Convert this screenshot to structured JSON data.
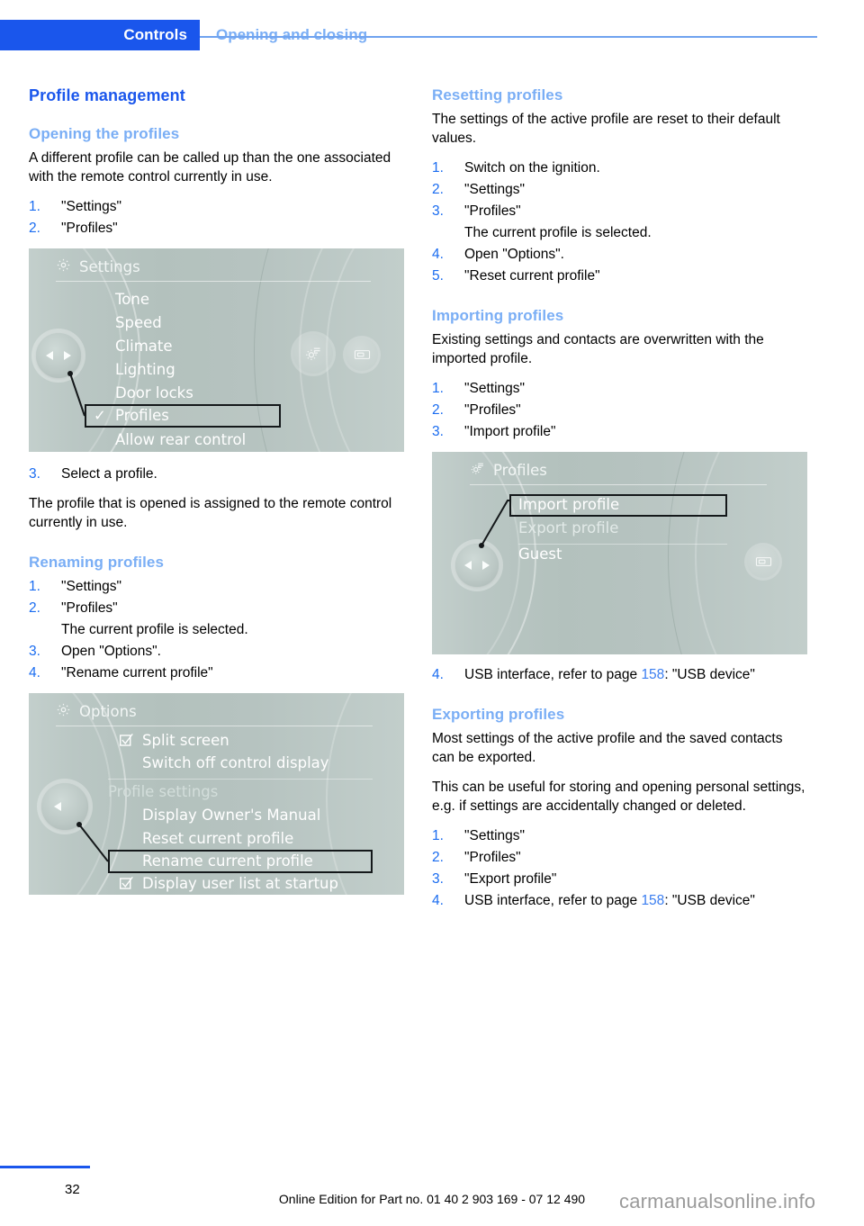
{
  "header": {
    "tab_label": "Controls",
    "section_label": "Opening and closing"
  },
  "left_column": {
    "title": "Profile management",
    "opening": {
      "heading": "Opening the profiles",
      "intro": "A different profile can be called up than the one associated with the remote control currently in use.",
      "steps": [
        {
          "num": "1.",
          "text": "\"Settings\""
        },
        {
          "num": "2.",
          "text": "\"Profiles\""
        }
      ],
      "step3": {
        "num": "3.",
        "text": "Select a profile."
      },
      "outro": "The profile that is opened is assigned to the remote control currently in use."
    },
    "renaming": {
      "heading": "Renaming profiles",
      "steps": [
        {
          "num": "1.",
          "text": "\"Settings\""
        },
        {
          "num": "2.",
          "text": "\"Profiles\""
        }
      ],
      "note": "The current profile is selected.",
      "steps2": [
        {
          "num": "3.",
          "text": "Open \"Options\"."
        },
        {
          "num": "4.",
          "text": "\"Rename current profile\""
        }
      ]
    }
  },
  "right_column": {
    "resetting": {
      "heading": "Resetting profiles",
      "intro": "The settings of the active profile are reset to their default values.",
      "steps": [
        {
          "num": "1.",
          "text": "Switch on the ignition."
        },
        {
          "num": "2.",
          "text": "\"Settings\""
        },
        {
          "num": "3.",
          "text": "\"Profiles\""
        }
      ],
      "note": "The current profile is selected.",
      "steps2": [
        {
          "num": "4.",
          "text": "Open \"Options\"."
        },
        {
          "num": "5.",
          "text": "\"Reset current profile\""
        }
      ]
    },
    "importing": {
      "heading": "Importing profiles",
      "intro": "Existing settings and contacts are overwritten with the imported profile.",
      "steps": [
        {
          "num": "1.",
          "text": "\"Settings\""
        },
        {
          "num": "2.",
          "text": "\"Profiles\""
        },
        {
          "num": "3.",
          "text": "\"Import profile\""
        }
      ],
      "step4_num": "4.",
      "step4_a": "USB interface, refer to page ",
      "step4_page": "158",
      "step4_b": ": \"USB device\""
    },
    "exporting": {
      "heading": "Exporting profiles",
      "intro1": "Most settings of the active profile and the saved contacts can be exported.",
      "intro2": "This can be useful for storing and opening personal settings, e.g. if settings are accidentally changed or deleted.",
      "steps": [
        {
          "num": "1.",
          "text": "\"Settings\""
        },
        {
          "num": "2.",
          "text": "\"Profiles\""
        },
        {
          "num": "3.",
          "text": "\"Export profile\""
        }
      ],
      "step4_num": "4.",
      "step4_a": "USB interface, refer to page ",
      "step4_page": "158",
      "step4_b": ": \"USB device\""
    }
  },
  "idrive_settings": {
    "title": "Settings",
    "icon": "gear-icon",
    "items": [
      {
        "label": "Tone",
        "selected": false,
        "checked": false
      },
      {
        "label": "Speed",
        "selected": false,
        "checked": false
      },
      {
        "label": "Climate",
        "selected": false,
        "checked": false
      },
      {
        "label": "Lighting",
        "selected": false,
        "checked": false
      },
      {
        "label": "Door locks",
        "selected": false,
        "checked": false
      },
      {
        "label": "Profiles",
        "selected": true,
        "checked": true
      },
      {
        "label": "Allow rear control",
        "selected": false,
        "checked": false
      }
    ],
    "check_glyph": "✓"
  },
  "idrive_options": {
    "title": "Options",
    "icon": "gear-icon",
    "items": [
      {
        "label": "Split screen",
        "checkbox": true
      },
      {
        "label": "Switch off control display",
        "checkbox": false
      },
      {
        "label": "Profile settings",
        "checkbox": false,
        "group_label": true
      },
      {
        "label": "Display Owner's Manual",
        "checkbox": false
      },
      {
        "label": "Reset current profile",
        "checkbox": false
      },
      {
        "label": "Rename current profile",
        "checkbox": false,
        "selected": true
      },
      {
        "label": "Display user list at startup",
        "checkbox": true
      }
    ]
  },
  "idrive_profiles": {
    "title": "Profiles",
    "icon": "gear-list-icon",
    "items": [
      {
        "label": "Import profile",
        "selected": true
      },
      {
        "label": "Export profile",
        "selected": false
      },
      {
        "label": "Guest",
        "selected": false
      }
    ]
  },
  "footer": {
    "page_number": "32",
    "edition_text": "Online Edition for Part no. 01 40 2 903 169 - 07 12 490",
    "watermark": "carmanualsonline.info"
  },
  "colors": {
    "accent_blue": "#1a56ec",
    "light_blue": "#7aaef5",
    "link_blue": "#3b7ef0",
    "idrive_bg": "#b8c5c2"
  }
}
